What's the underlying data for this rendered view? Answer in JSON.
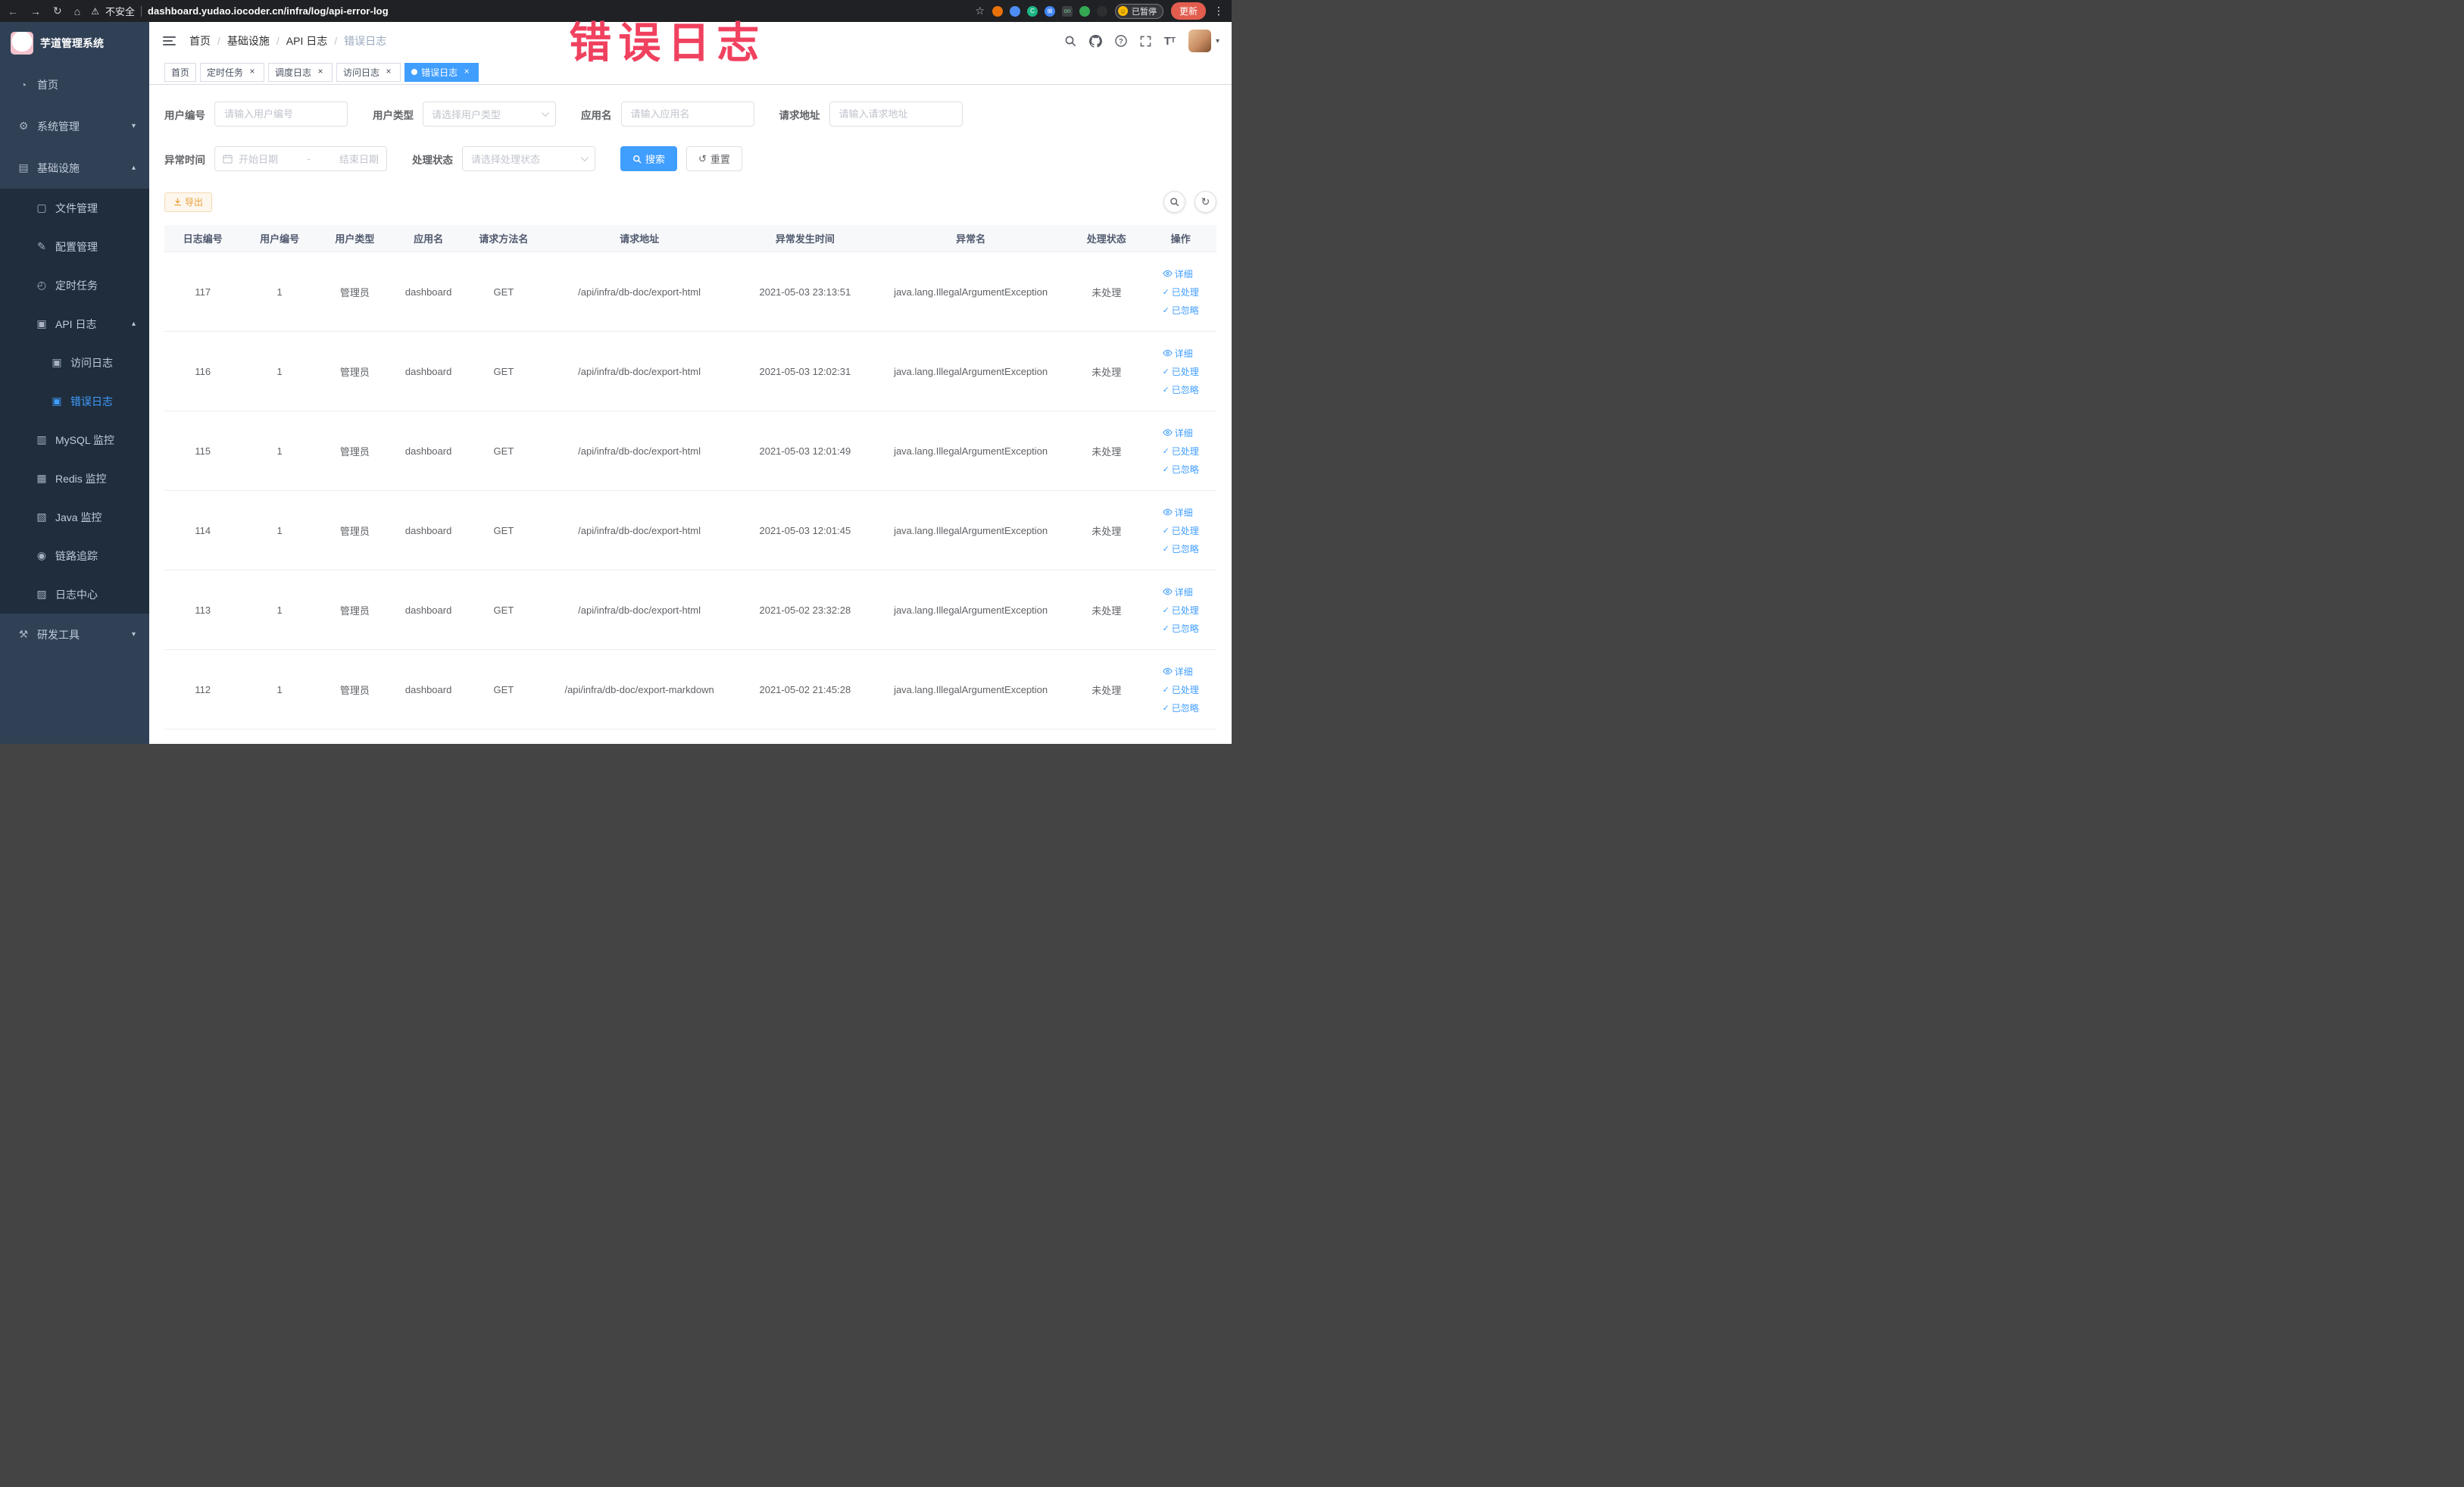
{
  "annotation": {
    "text": "错误日志"
  },
  "colors": {
    "primary": "#409EFF",
    "warning": "#e6a23c",
    "annotation": "#f0415f",
    "sidebar_bg": "#304156",
    "submenu_bg": "#1f2d3d"
  },
  "browser": {
    "security_label": "不安全",
    "url": "dashboard.yudao.iocoder.cn/infra/log/api-error-log",
    "paused_label": "已暂停",
    "update_label": "更新",
    "extensions": [
      {
        "key": "ext-orange-icon",
        "bg": "#e8710a",
        "text": "",
        "fg": "#fff",
        "square": false
      },
      {
        "key": "ext-blue-drop-icon",
        "bg": "#4e8df5",
        "text": "",
        "fg": "#fff",
        "square": false
      },
      {
        "key": "ext-green-circle-icon",
        "bg": "#1db584",
        "text": "C",
        "fg": "#fff",
        "square": false
      },
      {
        "key": "ext-blue-grid-icon",
        "bg": "#4285f4",
        "text": "⊞",
        "fg": "#fff",
        "square": false
      },
      {
        "key": "ext-on-badge-icon",
        "bg": "#3c4043",
        "text": "on",
        "fg": "#81c995",
        "square": true
      },
      {
        "key": "ext-green-leaf-icon",
        "bg": "#34a853",
        "text": "",
        "fg": "#fff",
        "square": false
      },
      {
        "key": "ext-paw-icon",
        "bg": "#2d2f31",
        "text": "",
        "fg": "#fff",
        "square": false
      }
    ]
  },
  "sidebar": {
    "logo_title": "芋道管理系统",
    "items": [
      {
        "key": "home",
        "label": "首页",
        "icon": "dashboard-icon",
        "glyph": "◔",
        "level": 1,
        "arrow": "",
        "active": false
      },
      {
        "key": "system",
        "label": "系统管理",
        "icon": "gear-icon",
        "glyph": "⚙",
        "level": 1,
        "arrow": "down",
        "active": false
      },
      {
        "key": "infra",
        "label": "基础设施",
        "icon": "infra-icon",
        "glyph": "▤",
        "level": 1,
        "arrow": "up",
        "active": false
      },
      {
        "key": "file",
        "label": "文件管理",
        "icon": "file-icon",
        "glyph": "▢",
        "level": 2,
        "arrow": "",
        "active": false
      },
      {
        "key": "config",
        "label": "配置管理",
        "icon": "edit-icon",
        "glyph": "✎",
        "level": 2,
        "arrow": "",
        "active": false
      },
      {
        "key": "job",
        "label": "定时任务",
        "icon": "timer-icon",
        "glyph": "◴",
        "level": 2,
        "arrow": "",
        "active": false
      },
      {
        "key": "api-log",
        "label": "API 日志",
        "icon": "log-icon",
        "glyph": "▣",
        "level": 2,
        "arrow": "up",
        "active": false
      },
      {
        "key": "access-log",
        "label": "访问日志",
        "icon": "access-log-icon",
        "glyph": "▣",
        "level": 3,
        "arrow": "",
        "active": false
      },
      {
        "key": "error-log",
        "label": "错误日志",
        "icon": "error-log-icon",
        "glyph": "▣",
        "level": 3,
        "arrow": "",
        "active": true
      },
      {
        "key": "mysql",
        "label": "MySQL 监控",
        "icon": "mysql-icon",
        "glyph": "▥",
        "level": 2,
        "arrow": "",
        "active": false
      },
      {
        "key": "redis",
        "label": "Redis 监控",
        "icon": "redis-icon",
        "glyph": "▦",
        "level": 2,
        "arrow": "",
        "active": false
      },
      {
        "key": "java",
        "label": "Java 监控",
        "icon": "java-icon",
        "glyph": "▧",
        "level": 2,
        "arrow": "",
        "active": false
      },
      {
        "key": "trace",
        "label": "链路追踪",
        "icon": "trace-icon",
        "glyph": "◉",
        "level": 2,
        "arrow": "",
        "active": false
      },
      {
        "key": "log-center",
        "label": "日志中心",
        "icon": "log-center-icon",
        "glyph": "▨",
        "level": 2,
        "arrow": "",
        "active": false
      },
      {
        "key": "dev-tools",
        "label": "研发工具",
        "icon": "tools-icon",
        "glyph": "⚒",
        "level": 1,
        "arrow": "down",
        "active": false
      }
    ]
  },
  "header": {
    "breadcrumb": [
      "首页",
      "基础设施",
      "API 日志",
      "错误日志"
    ]
  },
  "tabs": [
    {
      "label": "首页",
      "closable": false,
      "active": false
    },
    {
      "label": "定时任务",
      "closable": true,
      "active": false
    },
    {
      "label": "调度日志",
      "closable": true,
      "active": false
    },
    {
      "label": "访问日志",
      "closable": true,
      "active": false
    },
    {
      "label": "错误日志",
      "closable": true,
      "active": true
    }
  ],
  "filters": {
    "user_id": {
      "label": "用户编号",
      "placeholder": "请输入用户编号"
    },
    "user_type": {
      "label": "用户类型",
      "placeholder": "请选择用户类型"
    },
    "app_name": {
      "label": "应用名",
      "placeholder": "请输入应用名"
    },
    "request_url": {
      "label": "请求地址",
      "placeholder": "请输入请求地址"
    },
    "exception_time": {
      "label": "异常时间",
      "start_placeholder": "开始日期",
      "separator": "-",
      "end_placeholder": "结束日期"
    },
    "process_status": {
      "label": "处理状态",
      "placeholder": "请选择处理状态"
    },
    "search_label": "搜索",
    "reset_label": "重置"
  },
  "toolbar": {
    "export_label": "导出"
  },
  "table": {
    "columns": [
      "日志编号",
      "用户编号",
      "用户类型",
      "应用名",
      "请求方法名",
      "请求地址",
      "异常发生时间",
      "异常名",
      "处理状态",
      "操作"
    ],
    "action_labels": [
      "详细",
      "已处理",
      "已忽略"
    ],
    "rows": [
      {
        "id": "117",
        "user_id": "1",
        "user_type": "管理员",
        "app_name": "dashboard",
        "method": "GET",
        "url": "/api/infra/db-doc/export-html",
        "time": "2021-05-03 23:13:51",
        "exception": "java.lang.IllegalArgumentException",
        "status": "未处理"
      },
      {
        "id": "116",
        "user_id": "1",
        "user_type": "管理员",
        "app_name": "dashboard",
        "method": "GET",
        "url": "/api/infra/db-doc/export-html",
        "time": "2021-05-03 12:02:31",
        "exception": "java.lang.IllegalArgumentException",
        "status": "未处理"
      },
      {
        "id": "115",
        "user_id": "1",
        "user_type": "管理员",
        "app_name": "dashboard",
        "method": "GET",
        "url": "/api/infra/db-doc/export-html",
        "time": "2021-05-03 12:01:49",
        "exception": "java.lang.IllegalArgumentException",
        "status": "未处理"
      },
      {
        "id": "114",
        "user_id": "1",
        "user_type": "管理员",
        "app_name": "dashboard",
        "method": "GET",
        "url": "/api/infra/db-doc/export-html",
        "time": "2021-05-03 12:01:45",
        "exception": "java.lang.IllegalArgumentException",
        "status": "未处理"
      },
      {
        "id": "113",
        "user_id": "1",
        "user_type": "管理员",
        "app_name": "dashboard",
        "method": "GET",
        "url": "/api/infra/db-doc/export-html",
        "time": "2021-05-02 23:32:28",
        "exception": "java.lang.IllegalArgumentException",
        "status": "未处理"
      },
      {
        "id": "112",
        "user_id": "1",
        "user_type": "管理员",
        "app_name": "dashboard",
        "method": "GET",
        "url": "/api/infra/db-doc/export-markdown",
        "time": "2021-05-02 21:45:28",
        "exception": "java.lang.IllegalArgumentException",
        "status": "未处理"
      }
    ]
  }
}
